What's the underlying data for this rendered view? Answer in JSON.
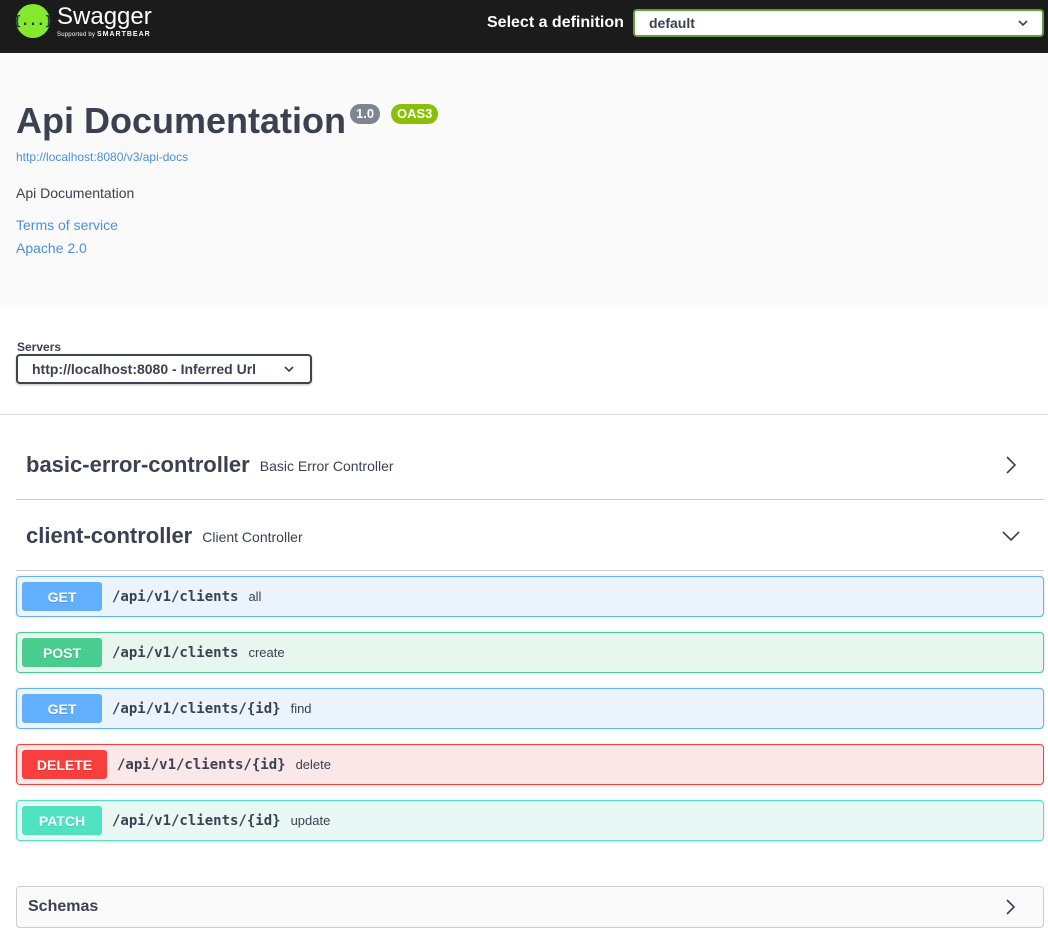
{
  "topbar": {
    "logo_glyph": "{...}",
    "logo_name": "Swagger",
    "logo_supported": "Supported by",
    "logo_smartbear": "SMARTBEAR",
    "definition_label": "Select a definition",
    "definition_value": "default"
  },
  "info": {
    "title": "Api Documentation",
    "version": "1.0",
    "oas": "OAS3",
    "url": "http://localhost:8080/v3/api-docs",
    "description": "Api Documentation",
    "terms": "Terms of service",
    "license": "Apache 2.0"
  },
  "servers": {
    "label": "Servers",
    "selected": "http://localhost:8080 - Inferred Url"
  },
  "tags": [
    {
      "name": "basic-error-controller",
      "description": "Basic Error Controller",
      "expanded": false
    },
    {
      "name": "client-controller",
      "description": "Client Controller",
      "expanded": true
    }
  ],
  "operations": [
    {
      "method": "GET",
      "path": "/api/v1/clients",
      "summary": "all"
    },
    {
      "method": "POST",
      "path": "/api/v1/clients",
      "summary": "create"
    },
    {
      "method": "GET",
      "path": "/api/v1/clients/{id}",
      "summary": "find"
    },
    {
      "method": "DELETE",
      "path": "/api/v1/clients/{id}",
      "summary": "delete"
    },
    {
      "method": "PATCH",
      "path": "/api/v1/clients/{id}",
      "summary": "update"
    }
  ],
  "schemas": {
    "label": "Schemas"
  },
  "colors": {
    "get": "#61affe",
    "post": "#49cc90",
    "delete": "#f93e3e",
    "patch": "#50e3c2",
    "brand": "#85ea2d",
    "topbar": "#1b1b1b"
  }
}
